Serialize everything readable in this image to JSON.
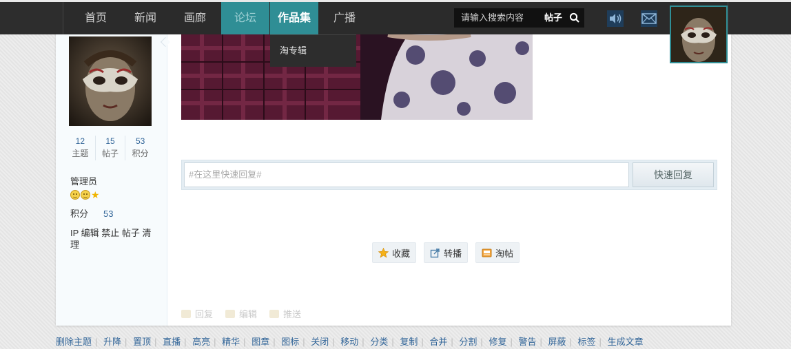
{
  "nav": {
    "items": [
      {
        "label": "首页"
      },
      {
        "label": "新闻"
      },
      {
        "label": "画廊"
      },
      {
        "label": "论坛"
      },
      {
        "label": "作品集"
      },
      {
        "label": "广播"
      }
    ],
    "search_placeholder": "请输入搜索内容",
    "search_type": "帖子",
    "dropdown_item": "淘专辑",
    "colors": {
      "bar": "#2d2d2d",
      "accent": "#2f8e95"
    }
  },
  "profile": {
    "stats": [
      {
        "value": "12",
        "label": "主题"
      },
      {
        "value": "15",
        "label": "帖子"
      },
      {
        "value": "53",
        "label": "积分"
      }
    ],
    "role": "管理员",
    "points_label": "积分",
    "points_value": "53",
    "admin_links": "IP 编辑 禁止 帖子 清理"
  },
  "reply": {
    "placeholder": "#在这里快速回复#",
    "button": "快速回复"
  },
  "actions": [
    {
      "label": "收藏",
      "icon": "star-icon"
    },
    {
      "label": "转播",
      "icon": "share-icon"
    },
    {
      "label": "淘帖",
      "icon": "collect-icon"
    }
  ],
  "post_footer": [
    {
      "label": "回复"
    },
    {
      "label": "编辑"
    },
    {
      "label": "推送"
    }
  ],
  "moderation": [
    "删除主题",
    "升降",
    "置顶",
    "直播",
    "高亮",
    "精华",
    "图章",
    "图标",
    "关闭",
    "移动",
    "分类",
    "复制",
    "合并",
    "分割",
    "修复",
    "警告",
    "屏蔽",
    "标签",
    "生成文章"
  ]
}
